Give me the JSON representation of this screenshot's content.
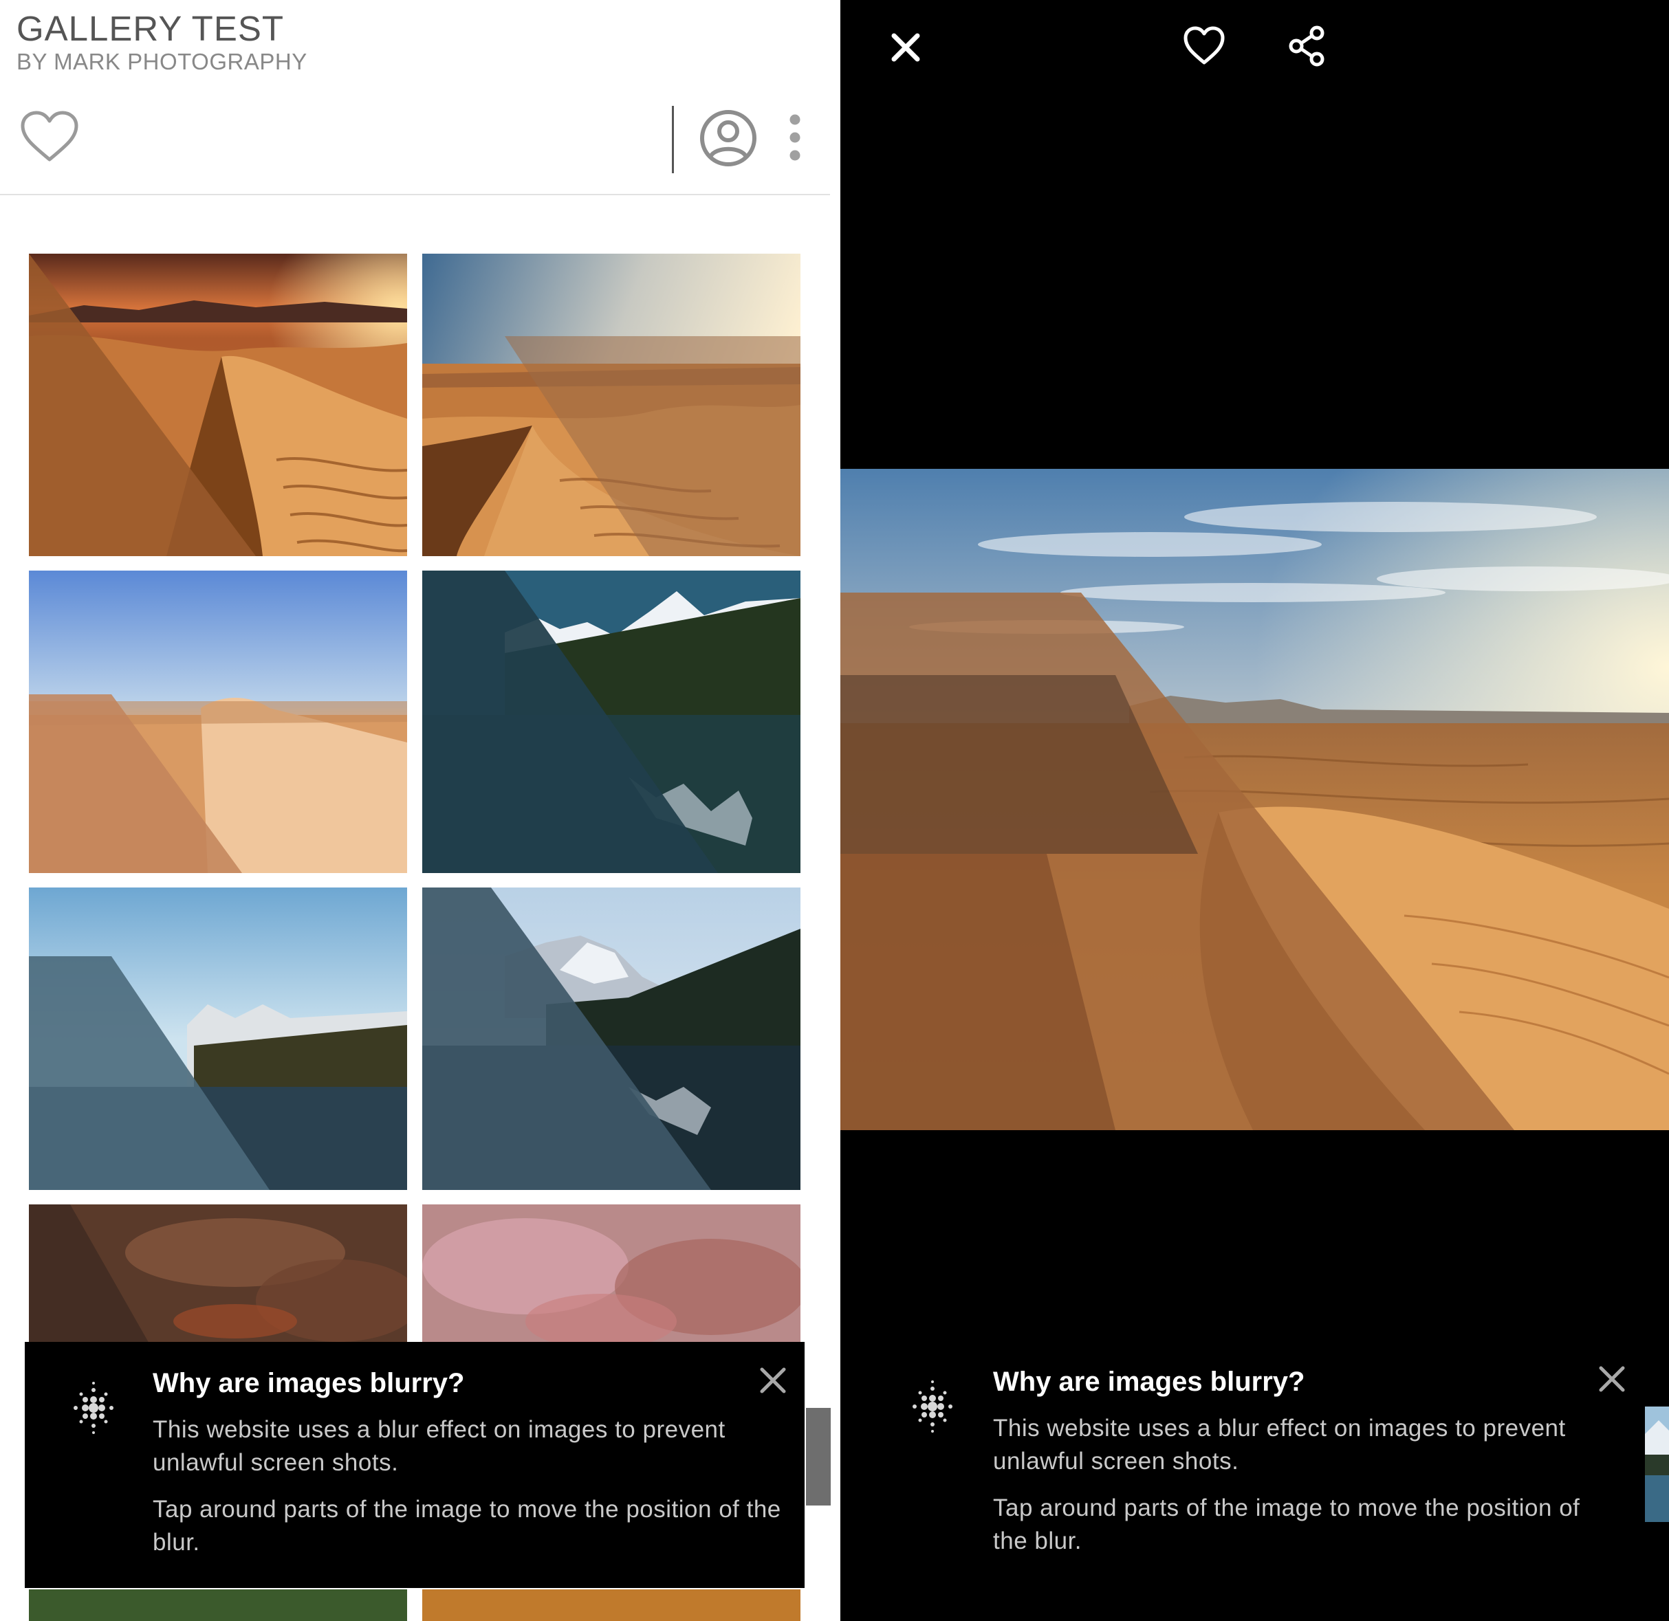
{
  "gallery": {
    "title": "GALLERY TEST",
    "subtitle": "BY MARK PHOTOGRAPHY"
  },
  "toolbar": {
    "favorite_icon": "heart-outline-icon",
    "account_icon": "user-circle-icon",
    "menu_icon": "more-vertical-icon"
  },
  "grid": {
    "images": [
      {
        "subject": "desert dunes at sunset"
      },
      {
        "subject": "desert dune ridge with footprints"
      },
      {
        "subject": "sand dune under blue sky"
      },
      {
        "subject": "mountain lake with pine forest"
      },
      {
        "subject": "lake with forested shore"
      },
      {
        "subject": "snowy mountain over lake"
      },
      {
        "subject": "autumn leaves"
      },
      {
        "subject": "pink blossoms"
      }
    ]
  },
  "notice": {
    "heading": "Why are images blurry?",
    "body_1": "This website uses a blur effect on images to prevent unlawful screen shots.",
    "body_2": "Tap around parts of the image to move the position of the blur.",
    "icon": "blur-dots-icon",
    "close_icon": "close-icon"
  },
  "viewer": {
    "close_icon": "close-icon",
    "favorite_icon": "heart-outline-icon",
    "share_icon": "share-icon",
    "image_subject": "desert dunes at sunrise"
  },
  "colors": {
    "sand": "#c57f3e",
    "overlay": "#000000",
    "muted_text": "#c9c9c9"
  }
}
